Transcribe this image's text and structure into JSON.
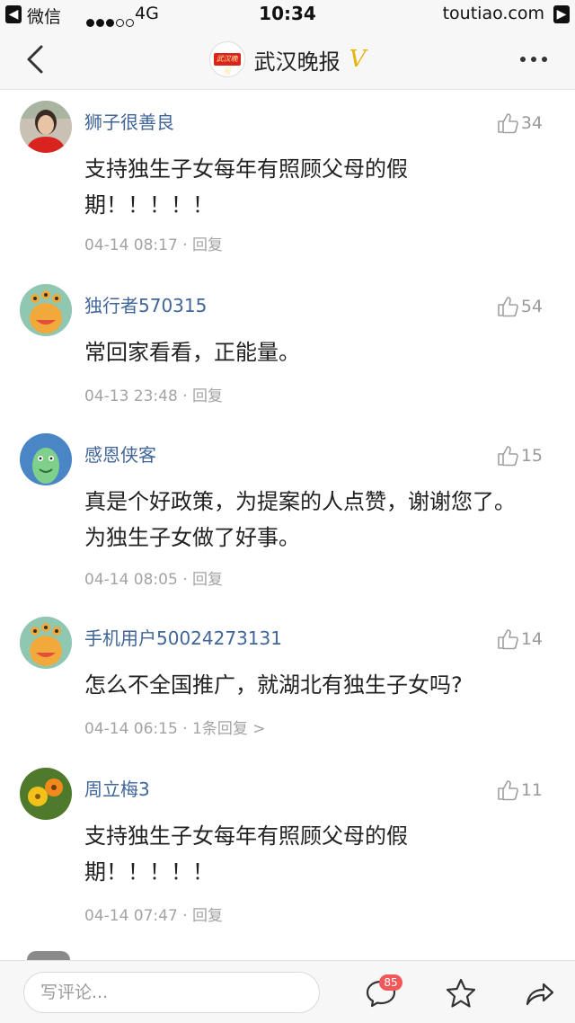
{
  "status_bar": {
    "back_app": "微信",
    "network": "4G",
    "time": "10:34",
    "domain": "toutiao.com"
  },
  "nav": {
    "title": "武汉晚报",
    "verified_mark": "V",
    "logo_text": "武汉晚报"
  },
  "comments": [
    {
      "user": "狮子很善良",
      "likes": "34",
      "text": "支持独生子女每年有照顾父母的假期！！！！！",
      "time": "04-14 08:17",
      "separator": "·",
      "reply": "回复"
    },
    {
      "user": "独行者570315",
      "likes": "54",
      "text": "常回家看看，正能量。",
      "time": "04-13 23:48",
      "separator": "·",
      "reply": "回复"
    },
    {
      "user": "感恩侠客",
      "likes": "15",
      "text": "真是个好政策，为提案的人点赞，谢谢您了。为独生子女做了好事。",
      "time": "04-14 08:05",
      "separator": "·",
      "reply": "回复"
    },
    {
      "user": "手机用户50024273131",
      "likes": "14",
      "text": "怎么不全国推广，就湖北有独生子女吗?",
      "time": "04-14 06:15",
      "separator": "·",
      "reply": "1条回复 >"
    },
    {
      "user": "周立梅3",
      "likes": "11",
      "text": "支持独生子女每年有照顾父母的假期！！！！！",
      "time": "04-14 07:47",
      "separator": "·",
      "reply": "回复"
    }
  ],
  "bottom_bar": {
    "comment_placeholder": "写评论...",
    "comment_badge": "85",
    "icons": [
      "comment-icon",
      "star-icon",
      "share-icon"
    ]
  },
  "colors": {
    "username": "#406599",
    "meta": "#a3a3a3",
    "badge": "#f0585a",
    "verified": "#e8b30c"
  }
}
